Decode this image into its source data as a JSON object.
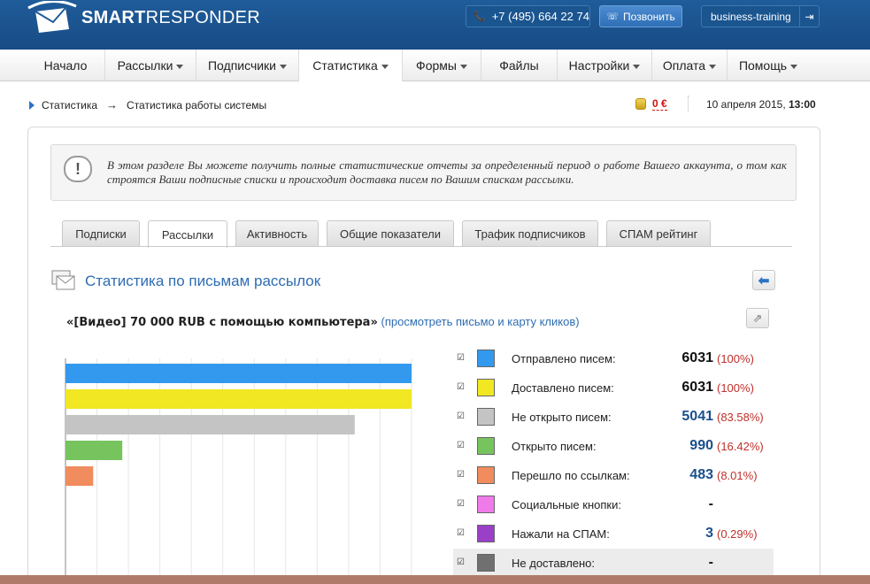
{
  "header": {
    "logo_bold": "SMART",
    "logo_light": "RESPONDER",
    "phone": "+7 (495) 664 22 74",
    "call_label": "Позвонить",
    "username": "business-training"
  },
  "menu": [
    {
      "label": "Начало",
      "dropdown": false,
      "width": 89
    },
    {
      "label": "Рассылки",
      "dropdown": true,
      "width": 103
    },
    {
      "label": "Подписчики",
      "dropdown": true,
      "width": 116
    },
    {
      "label": "Статистика",
      "dropdown": true,
      "width": 117
    },
    {
      "label": "Формы",
      "dropdown": true,
      "width": 89
    },
    {
      "label": "Файлы",
      "dropdown": false,
      "width": 86
    },
    {
      "label": "Настройки",
      "dropdown": true,
      "width": 107
    },
    {
      "label": "Оплата",
      "dropdown": true,
      "width": 85
    },
    {
      "label": "Помощь",
      "dropdown": true,
      "width": 92
    }
  ],
  "breadcrumb": {
    "root": "Статистика",
    "sep": "→",
    "current": "Статистика работы системы"
  },
  "balance": "0 €",
  "date": {
    "text": "10 апреля 2015, ",
    "time": "13:00"
  },
  "notice": "В этом разделе Вы можете получить полные статистические отчеты за определенный период о работе Вашего аккаунта, о том как строятся Ваши подписные списки и происходит доставка писем по Вашим спискам рассылки.",
  "tabs": [
    {
      "label": "Подписки",
      "active": false
    },
    {
      "label": "Рассылки",
      "active": true
    },
    {
      "label": "Активность",
      "active": false
    },
    {
      "label": "Общие показатели",
      "active": false
    },
    {
      "label": "Трафик подписчиков",
      "active": false
    },
    {
      "label": "СПАМ рейтинг",
      "active": false
    }
  ],
  "section_title": "Статистика по письмам рассылок",
  "mail": {
    "title": "«[Видео] 70 000 RUB с помощью компьютера»",
    "link": "(просмотреть письмо и карту кликов)"
  },
  "stats": [
    {
      "label": "Отправлено писем:",
      "value": "6031",
      "pct": "(100%)",
      "color": "#3399ee",
      "value_color": "#111111",
      "checked": true
    },
    {
      "label": "Доставлено писем:",
      "value": "6031",
      "pct": "(100%)",
      "color": "#f1e723",
      "value_color": "#111111",
      "checked": true
    },
    {
      "label": "Не открыто писем:",
      "value": "5041",
      "pct": "(83.58%)",
      "color": "#c4c4c4",
      "value_color": "#1a4f8c",
      "checked": true
    },
    {
      "label": "Открыто писем:",
      "value": "990",
      "pct": "(16.42%)",
      "color": "#77c45f",
      "value_color": "#1a4f8c",
      "checked": true
    },
    {
      "label": "Перешло по ссылкам:",
      "value": "483",
      "pct": "(8.01%)",
      "color": "#f08c5e",
      "value_color": "#1a4f8c",
      "checked": true
    },
    {
      "label": "Социальные кнопки:",
      "value": "-",
      "pct": "",
      "color": "#ef7ae9",
      "value_color": "#111111",
      "checked": true
    },
    {
      "label": "Нажали на СПАМ:",
      "value": "3",
      "pct": "(0.29%)",
      "color": "#9a3fc7",
      "value_color": "#1a4f8c",
      "checked": true
    },
    {
      "label": "Не доставлено:",
      "value": "-",
      "pct": "",
      "color": "#707070",
      "value_color": "#111111",
      "checked": true,
      "shaded": true
    }
  ],
  "chart_data": {
    "type": "bar",
    "orientation": "horizontal",
    "categories": [
      "Отправлено писем",
      "Доставлено писем",
      "Не открыто писем",
      "Открыто писем",
      "Перешло по ссылкам"
    ],
    "values": [
      6031,
      6031,
      5041,
      990,
      483
    ],
    "colors": [
      "#3399ee",
      "#f1e723",
      "#c4c4c4",
      "#77c45f",
      "#f08c5e"
    ],
    "xlim": [
      0,
      6031
    ],
    "grid": true
  }
}
